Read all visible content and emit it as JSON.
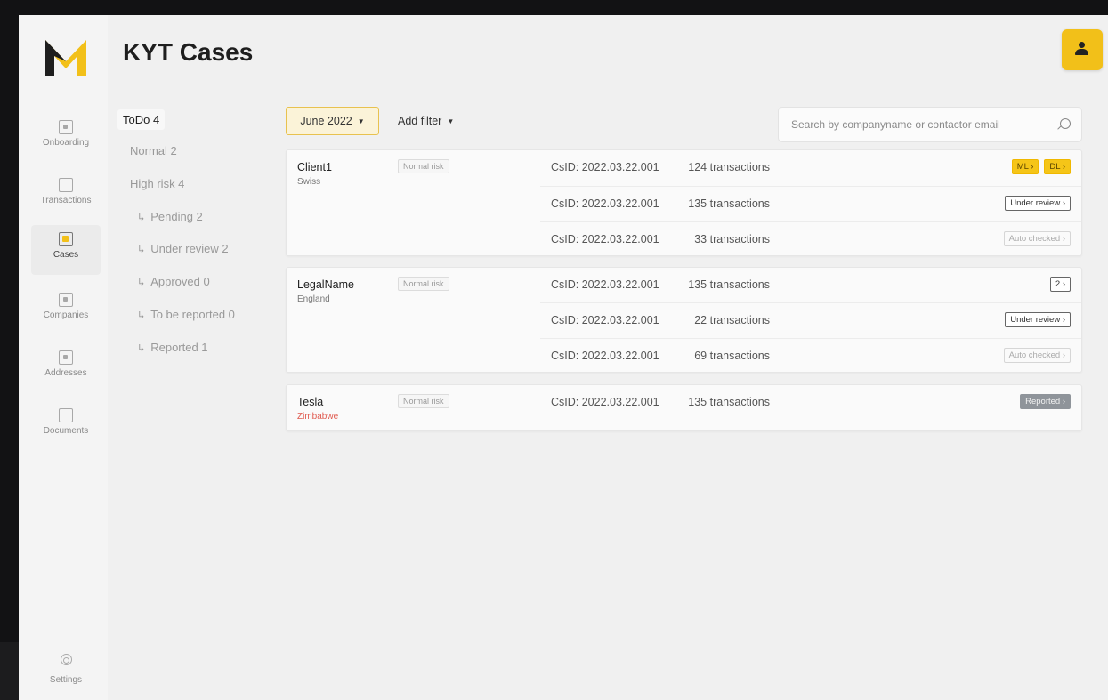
{
  "header": {
    "title": "KYT Cases"
  },
  "sidebar": {
    "items": [
      {
        "label": "Onboarding",
        "icon": "onboarding-icon"
      },
      {
        "label": "Transactions",
        "icon": "transactions-icon"
      },
      {
        "label": "Cases",
        "icon": "cases-icon",
        "active": true
      },
      {
        "label": "Companies",
        "icon": "companies-icon"
      },
      {
        "label": "Addresses",
        "icon": "addresses-icon"
      },
      {
        "label": "Documents",
        "icon": "documents-icon"
      }
    ],
    "settings_label": "Settings"
  },
  "tree": {
    "todo": "ToDo 4",
    "normal": "Normal 2",
    "high_risk": "High risk 4",
    "pending": "Pending 2",
    "under_review": "Under review 2",
    "approved": "Approved 0",
    "to_be_reported": "To be reported 0",
    "reported": "Reported 1",
    "arrow": "↳"
  },
  "toolbar": {
    "month": "June 2022",
    "add_filter": "Add filter",
    "caret": "▼",
    "search_placeholder": "Search by companyname or contactor email"
  },
  "cases": [
    {
      "name": "Client1",
      "country": "Swiss",
      "risk": "Normal risk",
      "rows": [
        {
          "csid": "CsID: 2022.03.22.001",
          "tx": "124 transactions",
          "tags": [
            "ML ›",
            "DL ›"
          ]
        },
        {
          "csid": "CsID: 2022.03.22.001",
          "tx": "135 transactions",
          "tags": [
            "Under review ›"
          ]
        },
        {
          "csid": "CsID: 2022.03.22.001",
          "tx": "33 transactions",
          "tags": [
            "Auto checked ›"
          ]
        }
      ]
    },
    {
      "name": "LegalName",
      "country": "England",
      "risk": "Normal risk",
      "rows": [
        {
          "csid": "CsID: 2022.03.22.001",
          "tx": "135 transactions",
          "tags": [
            "2 ›"
          ]
        },
        {
          "csid": "CsID: 2022.03.22.001",
          "tx": "22 transactions",
          "tags": [
            "Under review ›"
          ]
        },
        {
          "csid": "CsID: 2022.03.22.001",
          "tx": "69 transactions",
          "tags": [
            "Auto checked ›"
          ]
        }
      ]
    },
    {
      "name": "Tesla",
      "country": "Zimbabwe",
      "risk": "Normal risk",
      "rows": [
        {
          "csid": "CsID: 2022.03.22.001",
          "tx": "135 transactions",
          "tags": [
            "Reported ›"
          ]
        }
      ]
    }
  ],
  "colors": {
    "accent": "#f2c019",
    "country_alert": "#e05a4f",
    "reported_tag": "#8f949a"
  }
}
